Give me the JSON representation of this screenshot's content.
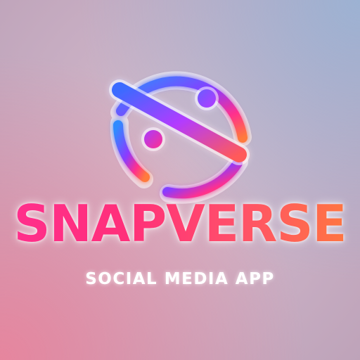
{
  "brand": {
    "name": "SNAPVERSE",
    "tagline": "SOCIAL MEDIA APP"
  },
  "logo": {
    "icon": "smiley-slash-icon"
  },
  "colors": {
    "gradient_blue": "#2f7bff",
    "gradient_purple": "#8b3bff",
    "gradient_pink": "#ff2f8e",
    "gradient_orange": "#ff7a3c",
    "tagline": "#ffffff"
  }
}
